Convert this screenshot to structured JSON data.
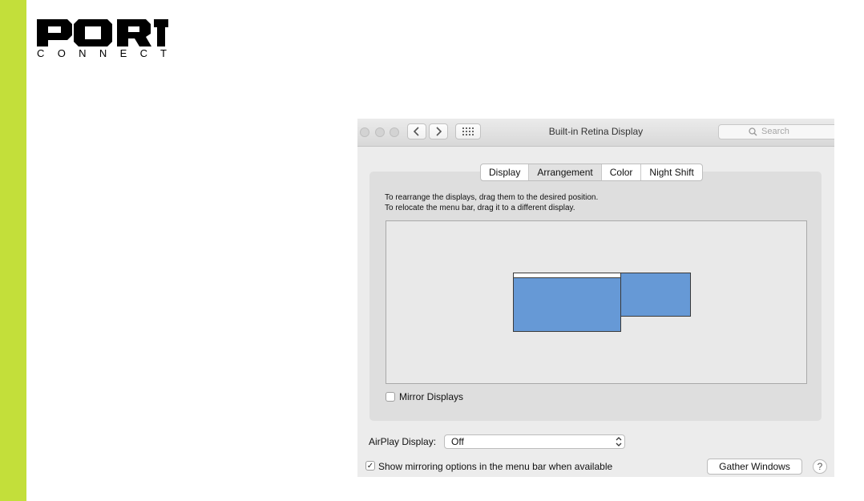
{
  "brand": {
    "logo_word": "PORT",
    "logo_sub": "CONNECT",
    "accent_color": "#c3df3a"
  },
  "window": {
    "title": "Built-in Retina Display",
    "search_placeholder": "Search",
    "back_icon": "chevron-left-icon",
    "forward_icon": "chevron-right-icon",
    "grid_icon": "grid-icon"
  },
  "tabs": [
    {
      "label": "Display",
      "active": false
    },
    {
      "label": "Arrangement",
      "active": true
    },
    {
      "label": "Color",
      "active": false
    },
    {
      "label": "Night Shift",
      "active": false
    }
  ],
  "arrangement": {
    "instruction_1": "To rearrange the displays, drag them to the desired position.",
    "instruction_2": "To relocate the menu bar, drag it to a different display.",
    "display_color": "#6699d6"
  },
  "mirror_displays": {
    "label": "Mirror Displays",
    "checked": false
  },
  "airplay": {
    "label": "AirPlay Display:",
    "value": "Off"
  },
  "show_mirroring": {
    "label": "Show mirroring options in the menu bar when available",
    "checked": true
  },
  "gather_windows_label": "Gather Windows",
  "help_label": "?"
}
